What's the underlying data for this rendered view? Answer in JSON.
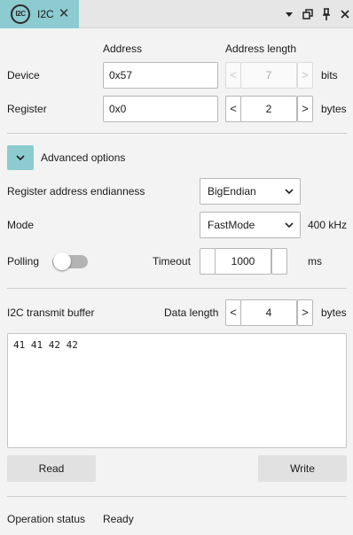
{
  "tab": {
    "logo_text": "I2C",
    "title": "I2C",
    "close_glyph": "✕"
  },
  "window_controls": {
    "menu_glyph": "▾",
    "restore_glyph": "🗗",
    "pin_glyph": "📌",
    "close_glyph": "✕"
  },
  "device_section": {
    "col_address": "Address",
    "col_address_length": "Address length",
    "device_label": "Device",
    "device_address": "0x57",
    "address_length": "7",
    "address_length_unit": "bits",
    "register_label": "Register",
    "register_address": "0x0",
    "register_length": "2",
    "register_length_unit": "bytes",
    "spin_dec": "<",
    "spin_inc": ">"
  },
  "advanced": {
    "toggle_glyph": "⌄",
    "label": "Advanced options",
    "endianness_label": "Register address endianness",
    "endianness_value": "BigEndian",
    "mode_label": "Mode",
    "mode_value": "FastMode",
    "mode_speed": "400 kHz",
    "polling_label": "Polling",
    "polling_on": false,
    "timeout_label": "Timeout",
    "timeout_value": "1000",
    "timeout_unit": "ms",
    "select_caret": "⌄"
  },
  "buffer": {
    "label": "I2C transmit buffer",
    "data_length_label": "Data length",
    "data_length_value": "4",
    "data_length_unit": "bytes",
    "content": "41 41 42 42"
  },
  "actions": {
    "read_label": "Read",
    "write_label": "Write"
  },
  "status": {
    "label": "Operation status",
    "value": "Ready"
  }
}
